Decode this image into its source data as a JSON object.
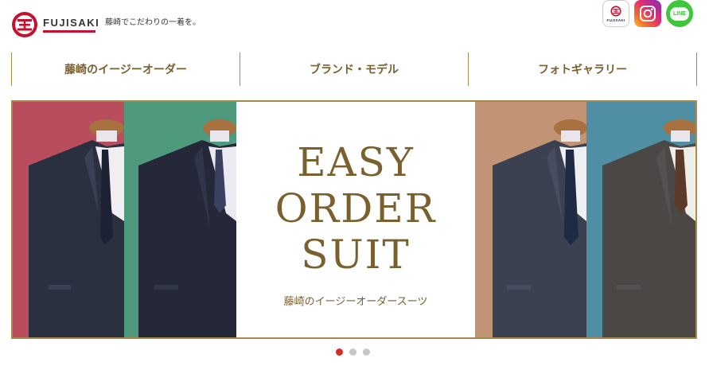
{
  "header": {
    "brand": "FUJISAKI",
    "tagline": "藤崎でこだわりの一着を。",
    "social": [
      {
        "name": "fujisaki",
        "label": "FUJISAKI"
      },
      {
        "name": "instagram"
      },
      {
        "name": "line",
        "label": "LINE"
      }
    ]
  },
  "nav": {
    "items": [
      "藤崎のイージーオーダー",
      "ブランド・モデル",
      "フォトギャラリー"
    ]
  },
  "banner": {
    "line1": "EASY",
    "line2": "ORDER",
    "line3": "SUIT",
    "subtitle": "藤崎のイージーオーダースーツ"
  },
  "carousel": {
    "count": 3,
    "active": 0
  },
  "colors": {
    "brand_red": "#c8102e",
    "gold": "#a88a4d",
    "gold_text": "#7a5f2f",
    "panel_red": "#b94d5e",
    "panel_green": "#4f9a7c",
    "panel_tan": "#c29476",
    "panel_blue": "#4f8ea3",
    "dot_active": "#d72b2b"
  }
}
